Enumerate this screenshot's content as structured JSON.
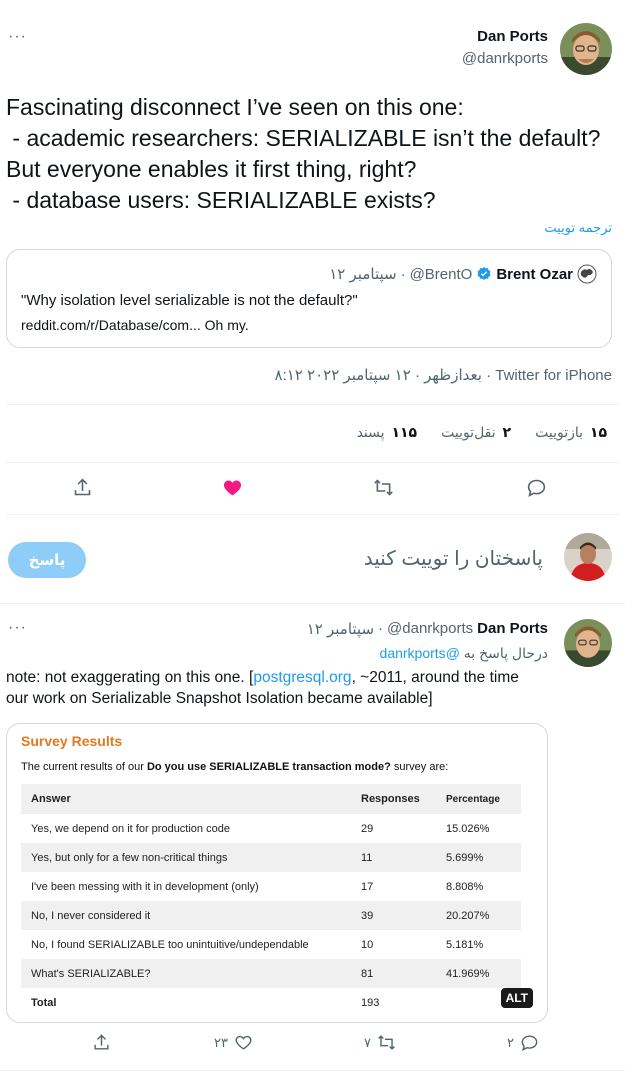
{
  "main_tweet": {
    "author_name": "Dan Ports",
    "author_handle": "@danrkports",
    "more_label": "···",
    "text": "Fascinating disconnect I’ve seen on this one:\n - academic researchers: SERIALIZABLE isn’t the default? But everyone enables it first thing, right?\n - database users: SERIALIZABLE exists?",
    "translate_label": "ترجمه توییت",
    "quote": {
      "name": "Brent Ozar",
      "handle": "@BrentO",
      "date": "۱۲ سپتامبر",
      "sep": "·",
      "text": "\"Why isolation level serializable is not the default?\"",
      "link": "reddit.com/r/Database/com...  Oh my."
    },
    "meta": "۸:۱۲ بعدازظهر · ۱۲ سپتامبر ۲۰۲۲ · Twitter for iPhone",
    "stats": {
      "retweets_count": "۱۵",
      "retweets_label": "بازتوییت",
      "quotes_count": "۲",
      "quotes_label": "نقل‌توییت",
      "likes_count": "۱۱۵",
      "likes_label": "پسند"
    }
  },
  "composer": {
    "placeholder": "پاسختان را توییت کنید",
    "button_label": "پاسخ"
  },
  "reply_tweet": {
    "author_name": "Dan Ports",
    "author_handle": "@danrkports",
    "date": "۱۲ سپتامبر",
    "sep": "·",
    "more_label": "···",
    "replying_prefix": "درحال پاسخ به",
    "replying_handle": "@danrkports",
    "text_before": "note: not exaggerating on this one. [",
    "text_link": "postgresql.org",
    "text_after": ", ~2011, around the time our work on Serializable Snapshot Isolation became available]",
    "alt_label": "ALT",
    "actions": {
      "reply_count": "۲",
      "retweet_count": "۷",
      "like_count": "۲۳"
    }
  },
  "survey": {
    "title": "Survey Results",
    "subtitle_prefix": "The current results of our ",
    "subtitle_bold": "Do you use SERIALIZABLE transaction mode?",
    "subtitle_suffix": " survey are:",
    "headers": [
      "Answer",
      "Responses",
      "Percentage"
    ],
    "rows": [
      [
        "Yes, we depend on it for production code",
        "29",
        "15.026%"
      ],
      [
        "Yes, but only for a few non-critical things",
        "11",
        "5.699%"
      ],
      [
        "I've been messing with it in development (only)",
        "17",
        "8.808%"
      ],
      [
        "No, I never considered it",
        "39",
        "20.207%"
      ],
      [
        "No, I found SERIALIZABLE too unintuitive/undependable",
        "10",
        "5.181%"
      ],
      [
        "What's SERIALIZABLE?",
        "81",
        "41.969%"
      ]
    ],
    "total": [
      "Total",
      "193",
      ""
    ]
  },
  "colors": {
    "accent": "#1d9bf0",
    "like": "#f91880",
    "muted": "#536471",
    "survey_title": "#e07a1f"
  }
}
